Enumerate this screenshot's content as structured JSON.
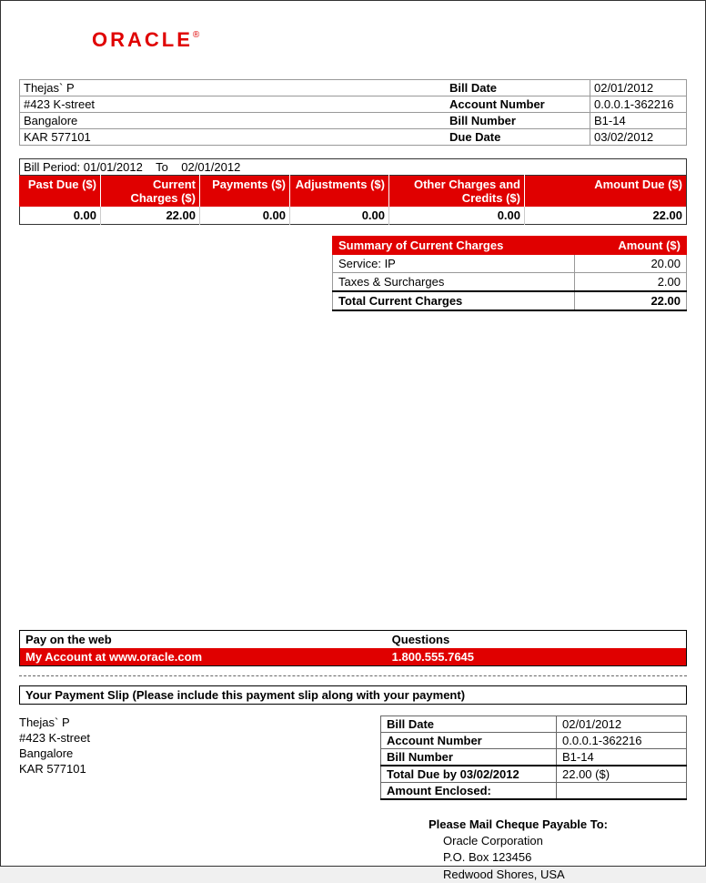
{
  "brand": "ORACLE",
  "customer": {
    "name": "Thejas` P",
    "street": "#423 K-street",
    "city": "Bangalore",
    "region_zip": "KAR 577101"
  },
  "bill_meta": {
    "bill_date_label": "Bill Date",
    "bill_date": "02/01/2012",
    "account_number_label": "Account Number",
    "account_number": "0.0.0.1-362216",
    "bill_number_label": "Bill Number",
    "bill_number": "B1-14",
    "due_date_label": "Due Date",
    "due_date": "03/02/2012"
  },
  "bill_period": {
    "label": "Bill Period:",
    "from": "01/01/2012",
    "to_label": "To",
    "to": "02/01/2012"
  },
  "charges": {
    "headers": {
      "past_due": "Past Due ($)",
      "current": "Current Charges ($)",
      "payments": "Payments ($)",
      "adjustments": "Adjustments ($)",
      "other": "Other Charges and Credits ($)",
      "amount_due": "Amount Due ($)"
    },
    "values": {
      "past_due": "0.00",
      "current": "22.00",
      "payments": "0.00",
      "adjustments": "0.00",
      "other": "0.00",
      "amount_due": "22.00"
    }
  },
  "summary": {
    "title": "Summary of Current Charges",
    "amount_header": "Amount ($)",
    "rows": [
      {
        "label": "Service: IP",
        "amount": "20.00"
      },
      {
        "label": "Taxes & Surcharges",
        "amount": "2.00"
      }
    ],
    "total_label": "Total Current Charges",
    "total_amount": "22.00"
  },
  "contact": {
    "web_label": "Pay on the web",
    "questions_label": "Questions",
    "web_value": "My Account at www.oracle.com",
    "phone": "1.800.555.7645"
  },
  "slip": {
    "header": "Your Payment Slip (Please include this payment slip along with your payment)",
    "bill_date_label": "Bill Date",
    "bill_date": "02/01/2012",
    "account_number_label": "Account Number",
    "account_number": "0.0.0.1-362216",
    "bill_number_label": "Bill Number",
    "bill_number": "B1-14",
    "total_due_label": "Total Due by 03/02/2012",
    "total_due": "22.00 ($)",
    "amount_enclosed_label": "Amount Enclosed:",
    "amount_enclosed": "",
    "mail_header": "Please Mail Cheque Payable To:",
    "mail_line1": "Oracle Corporation",
    "mail_line2": "P.O. Box 123456",
    "mail_line3": "Redwood Shores, USA"
  }
}
